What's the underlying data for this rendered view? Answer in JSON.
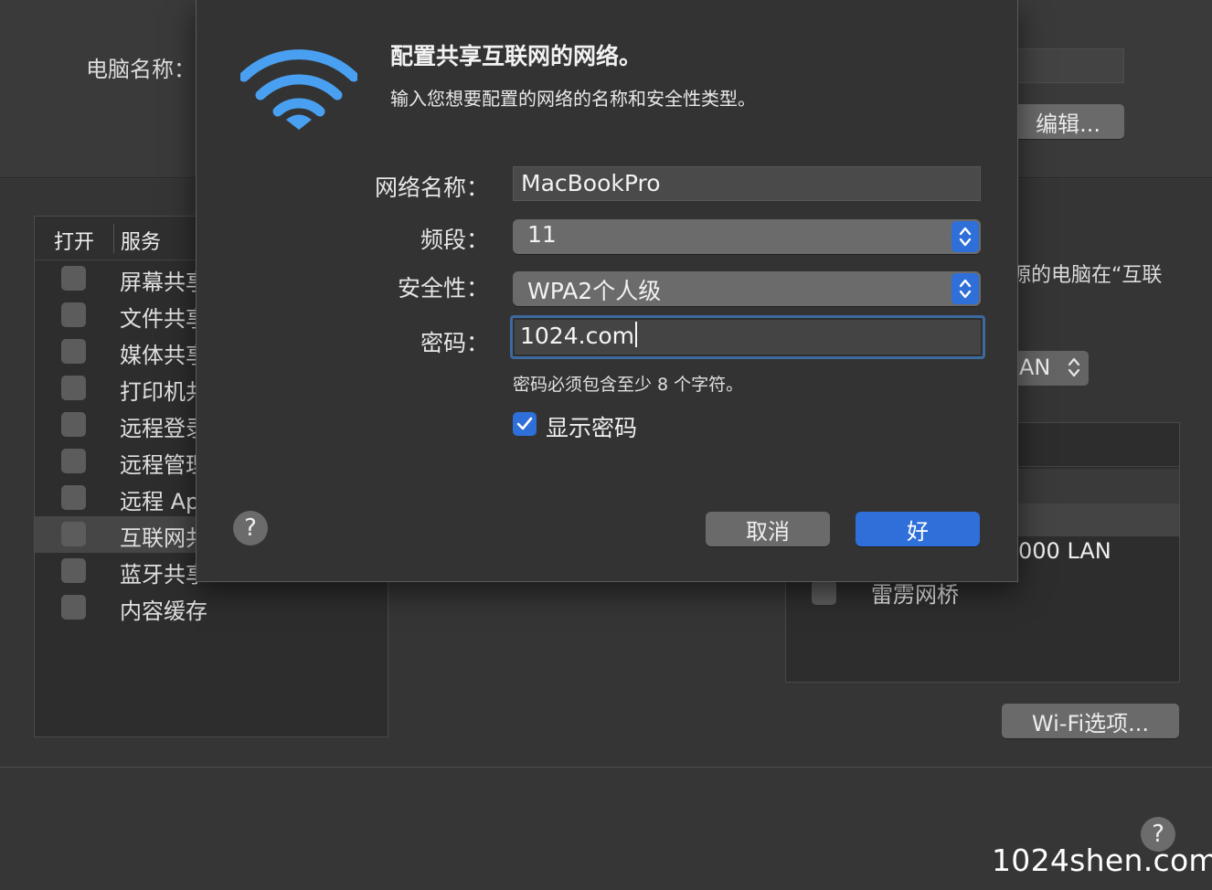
{
  "background": {
    "computer_name_label": "电脑名称：",
    "edit_button": "编辑...",
    "share_description_fragment": "源的电脑在“互联",
    "share_from_fragment": "AN",
    "services_header_on": "打开",
    "services_header_service": "服务",
    "services": [
      {
        "label": "屏幕共享",
        "selected": false
      },
      {
        "label": "文件共享",
        "selected": false
      },
      {
        "label": "媒体共享",
        "selected": false
      },
      {
        "label": "打印机共享",
        "selected": false
      },
      {
        "label": "远程登录",
        "selected": false
      },
      {
        "label": "远程管理",
        "selected": false
      },
      {
        "label": "远程 Apple 事件",
        "selected": false
      },
      {
        "label": "互联网共享",
        "selected": true
      },
      {
        "label": "蓝牙共享",
        "selected": false
      },
      {
        "label": "内容缓存",
        "selected": false
      }
    ],
    "port_lan_fragment": "000 LAN",
    "port_bridge": "雷雳网桥",
    "wifi_options_button": "Wi-Fi选项...",
    "help_glyph": "?"
  },
  "watermark": "1024shen.com",
  "sheet": {
    "icon": "wifi-icon",
    "title": "配置共享互联网的网络。",
    "subtitle": "输入您想要配置的网络的名称和安全性类型。",
    "network_name_label": "网络名称：",
    "network_name_value": "MacBookPro",
    "channel_label": "频段：",
    "channel_value": "11",
    "security_label": "安全性：",
    "security_value": "WPA2个人级",
    "password_label": "密码：",
    "password_value": "1024.com",
    "password_hint": "密码必须包含至少 8 个字符。",
    "show_password_label": "显示密码",
    "show_password_checked": true,
    "help_glyph": "?",
    "cancel_button": "取消",
    "ok_button": "好"
  },
  "colors": {
    "accent": "#2f6fd9",
    "wifi_icon": "#4aa0f0"
  }
}
